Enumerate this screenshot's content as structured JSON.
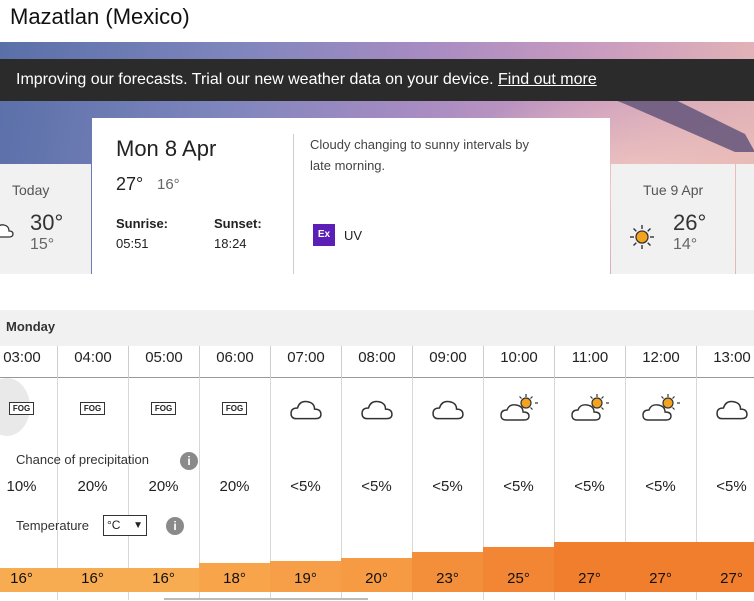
{
  "location": {
    "title": "Mazatlan (Mexico)"
  },
  "banner": {
    "text": "Improving our forecasts. Trial our new weather data on your device. ",
    "link": "Find out more"
  },
  "prev_day": {
    "label": "Today",
    "high": "30°",
    "low": "15°"
  },
  "selected_day": {
    "date": "Mon 8 Apr",
    "high": "27°",
    "low": "16°",
    "sunrise_label": "Sunrise:",
    "sunrise": "05:51",
    "sunset_label": "Sunset:",
    "sunset": "18:24",
    "description": "Cloudy changing to sunny intervals by late morning.",
    "uv_badge": "Ex",
    "uv_label": "UV"
  },
  "next_day": {
    "label": "Tue 9 Apr",
    "high": "26°",
    "low": "14°"
  },
  "hourly": {
    "day_label": "Monday",
    "precip_label": "Chance of precipitation",
    "temp_label": "Temperature",
    "unit": "°C",
    "info_glyph": "i",
    "hours": [
      {
        "time": "03:00",
        "icon": "fog-icon",
        "fog_text": "FOG",
        "precip": "10%",
        "temp": "16°",
        "temp_value": 16
      },
      {
        "time": "04:00",
        "icon": "fog-icon",
        "fog_text": "FOG",
        "precip": "20%",
        "temp": "16°",
        "temp_value": 16
      },
      {
        "time": "05:00",
        "icon": "fog-icon",
        "fog_text": "FOG",
        "precip": "20%",
        "temp": "16°",
        "temp_value": 16
      },
      {
        "time": "06:00",
        "icon": "fog-icon",
        "fog_text": "FOG",
        "precip": "20%",
        "temp": "18°",
        "temp_value": 18
      },
      {
        "time": "07:00",
        "icon": "cloud-icon",
        "precip": "<5%",
        "temp": "19°",
        "temp_value": 19
      },
      {
        "time": "08:00",
        "icon": "cloud-icon",
        "precip": "<5%",
        "temp": "20°",
        "temp_value": 20
      },
      {
        "time": "09:00",
        "icon": "cloud-icon",
        "precip": "<5%",
        "temp": "23°",
        "temp_value": 23
      },
      {
        "time": "10:00",
        "icon": "sun-cloud-icon",
        "precip": "<5%",
        "temp": "25°",
        "temp_value": 25
      },
      {
        "time": "11:00",
        "icon": "sun-cloud-icon",
        "precip": "<5%",
        "temp": "27°",
        "temp_value": 27
      },
      {
        "time": "12:00",
        "icon": "sun-cloud-icon",
        "precip": "<5%",
        "temp": "27°",
        "temp_value": 27
      },
      {
        "time": "13:00",
        "icon": "cloud-icon",
        "precip": "<5%",
        "temp": "27°",
        "temp_value": 27
      }
    ]
  },
  "colors": {
    "banner_bg": "#2b2b2b",
    "uv_extreme": "#5b1fb8",
    "temp_cool": "#f9b055",
    "temp_warm": "#f07a2a",
    "sun": "#f4a321"
  }
}
